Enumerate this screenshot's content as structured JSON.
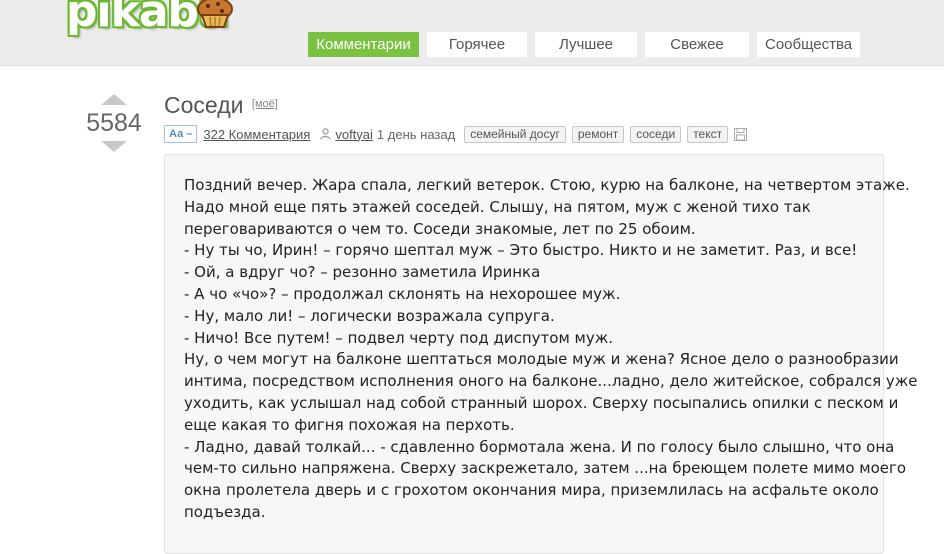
{
  "brand": {
    "logo_text": "pikabu",
    "logo_color": "#7cc242"
  },
  "nav": [
    {
      "label": "Комментарии",
      "active": true
    },
    {
      "label": "Горячее",
      "active": false
    },
    {
      "label": "Лучшее",
      "active": false
    },
    {
      "label": "Свежее",
      "active": false
    },
    {
      "label": "Сообщества",
      "active": false
    }
  ],
  "post": {
    "rating": "5584",
    "title": "Соседи",
    "mine_label": "[моё]",
    "font_toggle_label": "Аа –",
    "comments_label": "322 Комментария",
    "author": "voftyai",
    "time": "1 день назад",
    "tags": [
      "семейный досуг",
      "ремонт",
      "соседи",
      "текст"
    ],
    "body_lines": [
      "Поздний вечер. Жара спала, легкий  ветерок. Стою, курю на балконе, на четвертом этаже.",
      "Надо мной еще пять этажей соседей. Слышу, на пятом, муж с женой тихо так",
      "переговариваются о чем то. Соседи знакомые, лет по 25 обоим.",
      "- Ну ты чо, Ирин! – горячо шептал муж – Это быстро. Никто и не заметит. Раз, и все!",
      "- Ой, а вдруг чо? – резонно заметила Иринка",
      "- А чо «чо»? – продолжал склонять на нехорошее муж.",
      "- Ну, мало ли! – логически возражала супруга.",
      "- Ничо! Все путем! – подвел черту под диспутом муж.",
      "Ну, о чем могут на балконе шептаться молодые муж и жена? Ясное дело о разнообразии",
      "интима, посредством исполнения оного на балконе...ладно, дело житейское, собрался уже",
      "уходить, как услышал над собой странный шорох. Сверху посыпались опилки с песком и",
      "еще какая то фигня похожая на перхоть.",
      "- Ладно, давай толкай... - сдавленно бормотала жена. И по голосу было слышно, что она",
      "чем-то сильно напряжена. Сверху заскрежетало, затем ...на бреющем полете мимо моего",
      "окна пролетела дверь и с грохотом окончания мира, приземлилась на асфальте около",
      "подъезда."
    ]
  }
}
